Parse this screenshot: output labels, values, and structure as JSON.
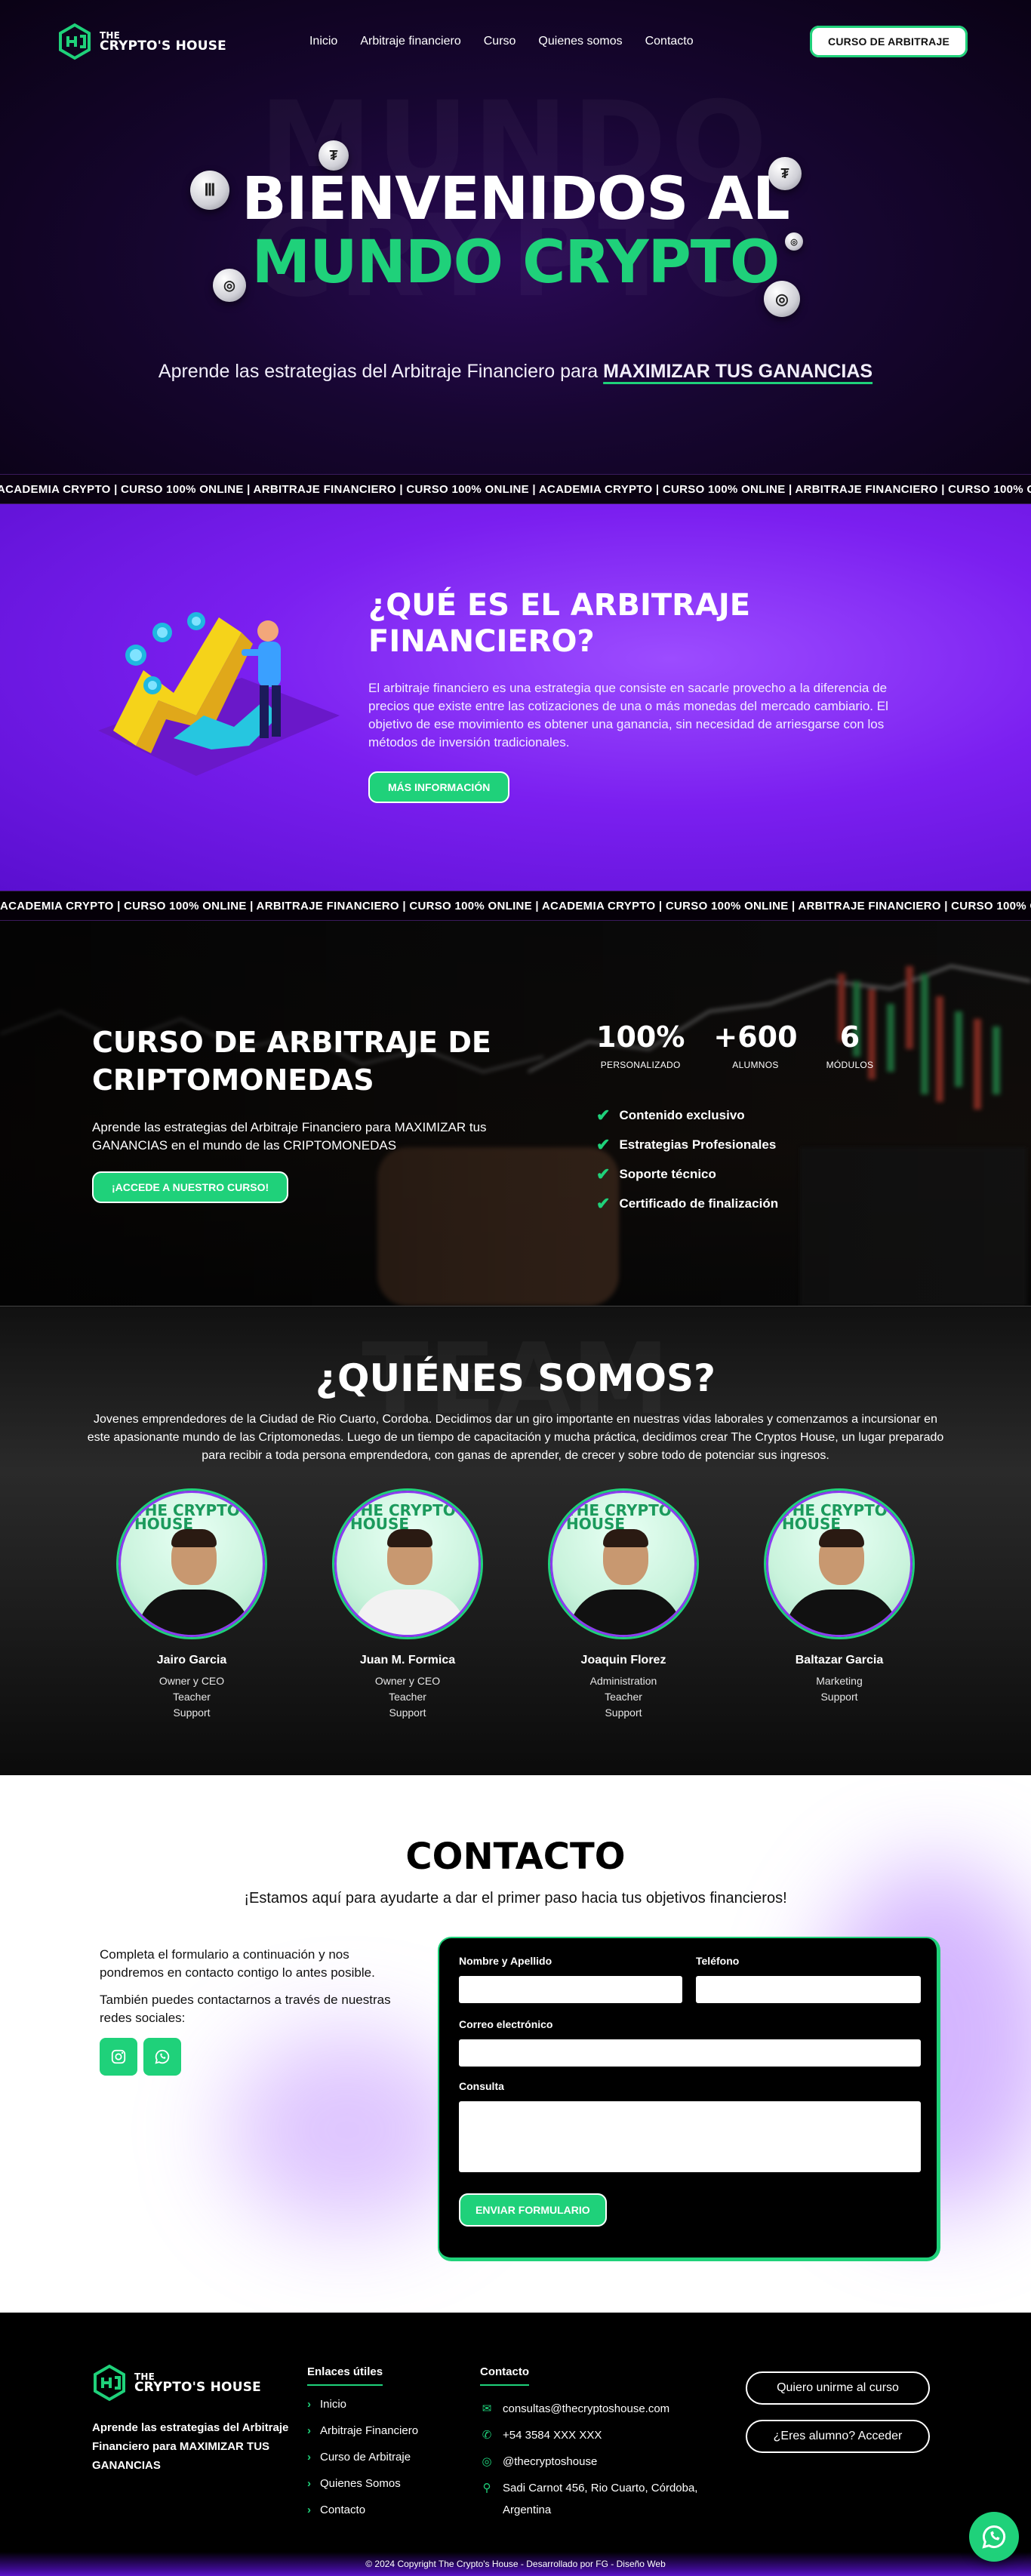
{
  "brand": {
    "line1": "THE",
    "line2": "CRYPTO'S HOUSE",
    "accent": "#1fd17a",
    "purple": "#7b1ff0"
  },
  "nav": {
    "items": [
      "Inicio",
      "Arbitraje financiero",
      "Curso",
      "Quienes somos",
      "Contacto"
    ],
    "cta": "CURSO DE ARBITRAJE"
  },
  "hero": {
    "background_word": "MUNDO CRYPTO",
    "title_line1": "BIENVENIDOS AL",
    "title_line2": "MUNDO CRYPTO",
    "subtitle_prefix": "Aprende las estrategias del Arbitraje Financiero para",
    "subtitle_highlight": "MAXIMIZAR TUS GANANCIAS"
  },
  "ticker": {
    "text": "ACADEMIA CRYPTO  |  CURSO 100% ONLINE  |  ARBITRAJE FINANCIERO  |  CURSO 100% ONLINE  |  ACADEMIA CRYPTO  |  CURSO 100% ONLINE  |  ARBITRAJE FINANCIERO  |  CURSO 100% ONLINE  |  ACADEMIA CRYPTO",
    "text2": "ACADEMIA CRYPTO  |  CURSO 100% ONLINE  |  ARBITRAJE FINANCIERO  |  CURSO 100% ONLINE  |  ACADEMIA CRYPTO  |  CURSO 100% ONLINE  |  ARBITRAJE FINANCIERO  |  CURSO 100% ONLINE  |  ACADEMIA CRYPTO"
  },
  "que_es": {
    "title": "¿QUÉ ES EL ARBITRAJE FINANCIERO?",
    "body": "El arbitraje financiero es una estrategia que consiste en sacarle provecho a la diferencia de precios que existe entre las cotizaciones de una o más monedas del mercado cambiario. El objetivo de ese movimiento es obtener una ganancia, sin necesidad de arriesgarse con los métodos de inversión tradicionales.",
    "button": "MÁS INFORMACIÓN"
  },
  "curso": {
    "title": "CURSO DE ARBITRAJE DE CRIPTOMONEDAS",
    "body": "Aprende las estrategias del Arbitraje Financiero para MAXIMIZAR tus GANANCIAS en el mundo de las CRIPTOMONEDAS",
    "button": "¡ACCEDE A NUESTRO CURSO!",
    "stats": [
      {
        "value": "100%",
        "label": "PERSONALIZADO"
      },
      {
        "value": "+600",
        "label": "ALUMNOS"
      },
      {
        "value": "6",
        "label": "MÓDULOS"
      }
    ],
    "features": [
      "Contenido exclusivo",
      "Estrategias Profesionales",
      "Soporte técnico",
      "Certificado de finalización"
    ]
  },
  "quienes": {
    "background_word": "TEAM",
    "title": "¿QUIÉNES SOMOS?",
    "intro": "Jovenes emprendedores de la Ciudad de Rio Cuarto, Cordoba. Decidimos dar un giro importante en nuestras vidas laborales y comenzamos a incursionar en este apasionante mundo de las Criptomonedas. Luego de un tiempo de capacitación y mucha práctica, decidimos crear The Cryptos House, un lugar preparado para recibir a toda persona emprendedora, con ganas de aprender, de crecer y sobre todo de potenciar sus ingresos.",
    "team": [
      {
        "name": "Jairo Garcia",
        "roles": [
          "Owner y CEO",
          "Teacher",
          "Support"
        ],
        "watermark": "THE CRYPTO'S HOUSE"
      },
      {
        "name": "Juan M. Formica",
        "roles": [
          "Owner y CEO",
          "Teacher",
          "Support"
        ],
        "watermark": "THE CRYPTO'S HOUSE"
      },
      {
        "name": "Joaquin Florez",
        "roles": [
          "Administration",
          "Teacher",
          "Support"
        ],
        "watermark": "THE CRYPTO'S HOUSE"
      },
      {
        "name": "Baltazar Garcia",
        "roles": [
          "Marketing",
          "Support"
        ],
        "watermark": "THE CRYPTO'S HOUSE"
      }
    ]
  },
  "contacto": {
    "title": "CONTACTO",
    "subtitle": "¡Estamos aquí para ayudarte a dar el primer paso hacia tus objetivos financieros!",
    "left_p1": "Completa el formulario a continuación y nos pondremos en contacto contigo lo antes posible.",
    "left_p2": "También puedes contactarnos a través de nuestras redes sociales:",
    "form": {
      "name_label": "Nombre y Apellido",
      "phone_label": "Teléfono",
      "email_label": "Correo electrónico",
      "message_label": "Consulta",
      "submit": "ENVIAR FORMULARIO"
    }
  },
  "footer": {
    "about": "Aprende las estrategias del Arbitraje Financiero para MAXIMIZAR TUS GANANCIAS",
    "links_title": "Enlaces útiles",
    "links": [
      "Inicio",
      "Arbitraje Financiero",
      "Curso de Arbitraje",
      "Quienes Somos",
      "Contacto"
    ],
    "contact_title": "Contacto",
    "email": "consultas@thecryptoshouse.com",
    "phone": "+54 3584 XXX XXX",
    "instagram": "@thecryptoshouse",
    "address": "Sadi Carnot 456, Rio Cuarto, Córdoba, Argentina",
    "btn_join": "Quiero unirme al curso",
    "btn_login": "¿Eres alumno? Acceder",
    "copyright": "© 2024 Copyright The Crypto's House - Desarrollado por FG - Diseño Web"
  }
}
